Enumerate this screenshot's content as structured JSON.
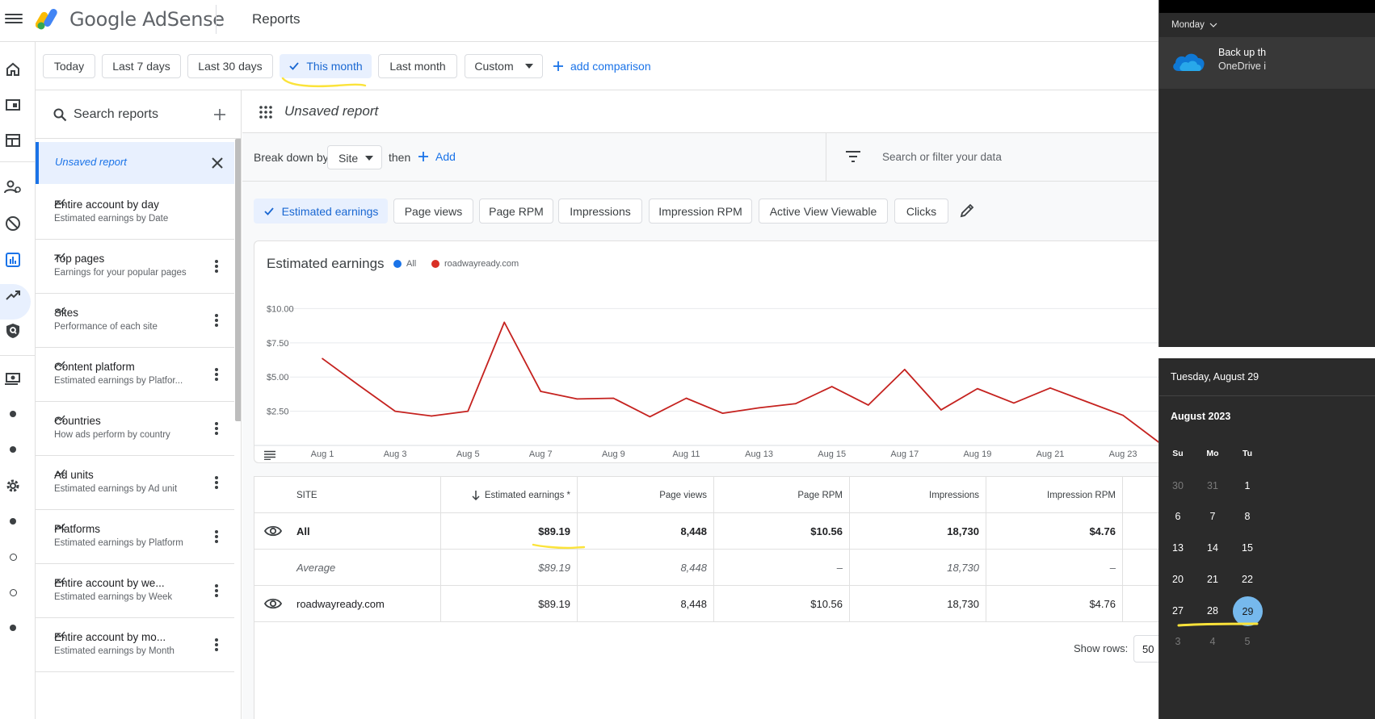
{
  "app": {
    "brand": "Google AdSense",
    "page_title": "Reports"
  },
  "date_range": {
    "options": [
      "Today",
      "Last 7 days",
      "Last 30 days",
      "This month",
      "Last month",
      "Custom"
    ],
    "active": "This month",
    "add_comparison": "add comparison"
  },
  "sidebar": {
    "search_label": "Search reports",
    "unsaved": "Unsaved report",
    "items": [
      {
        "title": "Entire account by day",
        "subtitle": "Estimated earnings by Date"
      },
      {
        "title": "Top pages",
        "subtitle": "Earnings for your popular pages"
      },
      {
        "title": "Sites",
        "subtitle": "Performance of each site"
      },
      {
        "title": "Content platform",
        "subtitle": "Estimated earnings by Platfor..."
      },
      {
        "title": "Countries",
        "subtitle": "How ads perform by country"
      },
      {
        "title": "Ad units",
        "subtitle": "Estimated earnings by Ad unit"
      },
      {
        "title": "Platforms",
        "subtitle": "Estimated earnings by Platform"
      },
      {
        "title": "Entire account by we...",
        "subtitle": "Estimated earnings by Week"
      },
      {
        "title": "Entire account by mo...",
        "subtitle": "Estimated earnings by Month"
      }
    ]
  },
  "report": {
    "name": "Unsaved report",
    "breakdown_label": "Break down by",
    "breakdown_value": "Site",
    "then_label": "then",
    "add_label": "Add",
    "filter_placeholder": "Search or filter your data",
    "metrics": [
      "Estimated earnings",
      "Page views",
      "Page RPM",
      "Impressions",
      "Impression RPM",
      "Active View Viewable",
      "Clicks"
    ],
    "active_metric": "Estimated earnings"
  },
  "chart_data": {
    "type": "line",
    "title": "Estimated earnings",
    "legend": [
      {
        "name": "All",
        "color": "#1a73e8"
      },
      {
        "name": "roadwayready.com",
        "color": "#d93025"
      }
    ],
    "y_ticks": [
      "$10.00",
      "$7.50",
      "$5.00",
      "$2.50"
    ],
    "y_tick_values": [
      10,
      7.5,
      5,
      2.5
    ],
    "ylim": [
      0,
      11.5
    ],
    "x_tick_labels": [
      "Aug 1",
      "Aug 3",
      "Aug 5",
      "Aug 7",
      "Aug 9",
      "Aug 11",
      "Aug 13",
      "Aug 15",
      "Aug 17",
      "Aug 19",
      "Aug 21",
      "Aug 23"
    ],
    "x_days": [
      1,
      2,
      3,
      4,
      5,
      6,
      7,
      8,
      9,
      10,
      11,
      12,
      13,
      14,
      15,
      16,
      17,
      18,
      19,
      20,
      21,
      22,
      23,
      24
    ],
    "series": [
      {
        "name": "roadwayready.com",
        "color": "#c5221f",
        "values": [
          6.35,
          4.4,
          2.5,
          2.15,
          2.5,
          9.0,
          3.95,
          3.4,
          3.45,
          2.1,
          3.45,
          2.35,
          2.75,
          3.05,
          4.3,
          2.95,
          5.55,
          2.6,
          4.15,
          3.1,
          4.2,
          3.2,
          2.2,
          0.2
        ]
      }
    ]
  },
  "table": {
    "headers": [
      "SITE",
      "Estimated earnings *",
      "Page views",
      "Page RPM",
      "Impressions",
      "Impression RPM"
    ],
    "rows": [
      {
        "site": "All",
        "earnings": "$89.19",
        "page_views": "8,448",
        "page_rpm": "$10.56",
        "impressions": "18,730",
        "impression_rpm": "$4.76"
      },
      {
        "site": "Average",
        "earnings": "$89.19",
        "page_views": "8,448",
        "page_rpm": "–",
        "impressions": "18,730",
        "impression_rpm": "–"
      },
      {
        "site": "roadwayready.com",
        "earnings": "$89.19",
        "page_views": "8,448",
        "page_rpm": "$10.56",
        "impressions": "18,730",
        "impression_rpm": "$4.76"
      }
    ],
    "show_rows_label": "Show rows:",
    "show_rows_value": "50"
  },
  "windows": {
    "notifications_day": "Monday",
    "notification_line1": "Back up th",
    "notification_line2": "OneDrive i",
    "calendar_date": "Tuesday, August 29",
    "calendar_month": "August 2023",
    "weekdays": [
      "Su",
      "Mo",
      "Tu"
    ],
    "weeks": [
      [
        "30",
        "31",
        "1"
      ],
      [
        "6",
        "7",
        "8"
      ],
      [
        "13",
        "14",
        "15"
      ],
      [
        "20",
        "21",
        "22"
      ],
      [
        "27",
        "28",
        "29"
      ],
      [
        "3",
        "4",
        "5"
      ]
    ],
    "today": "29"
  },
  "colors": {
    "accent": "#1a73e8",
    "series": "#c5221f",
    "highlight": "#fbe33a",
    "today": "#76b9ed"
  }
}
